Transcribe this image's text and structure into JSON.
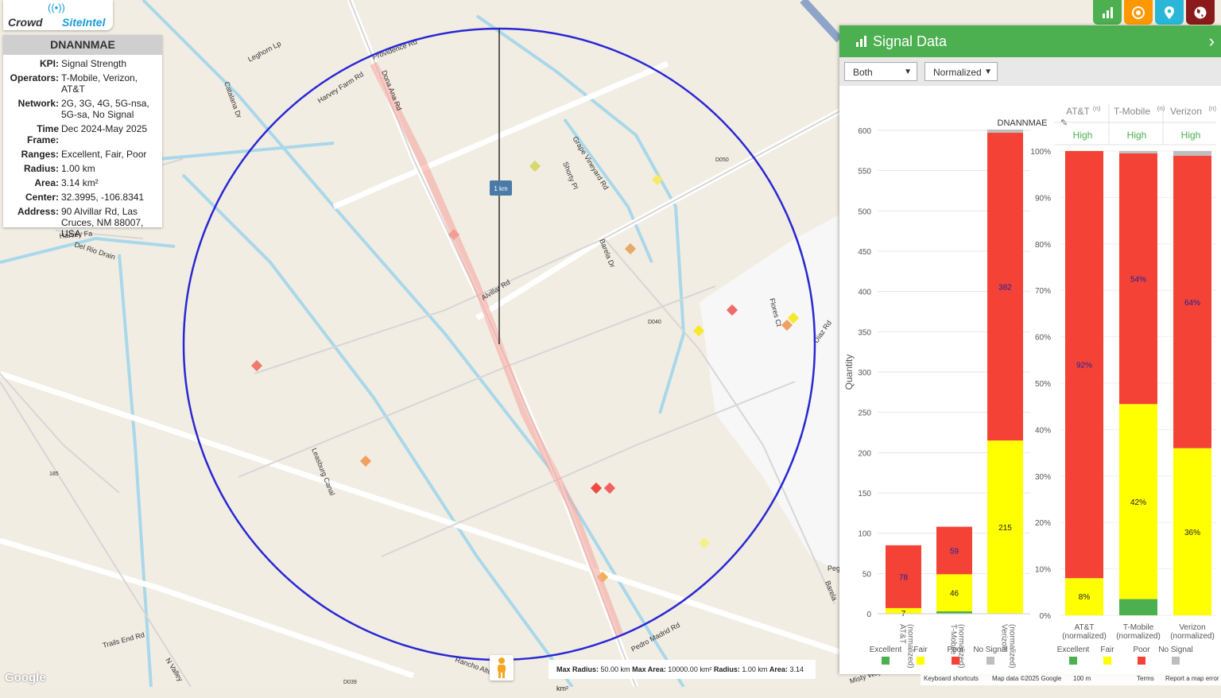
{
  "app": {
    "logo_left": "Crowd",
    "logo_right": "SiteIntel"
  },
  "info": {
    "title": "DNANNMAE",
    "rows": [
      {
        "k": "KPI:",
        "v": "Signal Strength"
      },
      {
        "k": "Operators:",
        "v": "T-Mobile, Verizon, AT&T"
      },
      {
        "k": "Network:",
        "v": "2G, 3G, 4G, 5G-nsa, 5G-sa, No Signal"
      },
      {
        "k": "Time Frame:",
        "v": "Dec 2024-May 2025"
      },
      {
        "k": "Ranges:",
        "v": "Excellent, Fair, Poor"
      },
      {
        "k": "Radius:",
        "v": "1.00 km"
      },
      {
        "k": "Area:",
        "v": "3.14 km²"
      },
      {
        "k": "Center:",
        "v": "32.3995, -106.8341"
      },
      {
        "k": "Address:",
        "v": "90 Alvillar Rd, Las Cruces, NM 88007, USA"
      }
    ]
  },
  "top_buttons": [
    {
      "icon": "bar-chart-icon",
      "color": "#4caf50"
    },
    {
      "icon": "target-icon",
      "color": "#ff9800"
    },
    {
      "icon": "location-pin-icon",
      "color": "#29b6d8"
    },
    {
      "icon": "globe-icon",
      "color": "#8b1a1a"
    }
  ],
  "map": {
    "scale_label": "1 km",
    "roads": [
      "Dona Ana Rd",
      "Alvillar Rd",
      "Harvey Farm Rd",
      "Providence Rd",
      "Leghorn Lp",
      "Catalana Dr",
      "Del Rio Drain",
      "Harvey Fa",
      "Leasburg Canal",
      "Barela Dr",
      "Grape Vineyard Rd",
      "Shorty Pl",
      "Flores Ct",
      "Diaz Rd",
      "Pedro Madrid Rd",
      "Trails End Rd",
      "N Valley",
      "Rancho Alto",
      "Peg",
      "Barela",
      "D050",
      "D040",
      "D039",
      "185",
      "Misty Way"
    ]
  },
  "bottom_stats": {
    "max_radius_label": "Max Radius:",
    "max_radius": "50.00 km",
    "max_area_label": "Max Area:",
    "max_area": "10000.00 km²",
    "radius_label": "Radius:",
    "radius": "1.00 km",
    "area_label": "Area:",
    "area": "3.14 km²"
  },
  "map_footer": {
    "keyboard": "Keyboard shortcuts",
    "mapdata": "Map data ©2025 Google",
    "scale": "100 m",
    "terms": "Terms",
    "report": "Report a map error",
    "google": "Google"
  },
  "panel": {
    "title": "Signal Data",
    "select_1": "Both",
    "select_2": "Normalized"
  },
  "colors": {
    "excellent": "#4caf50",
    "fair": "#ffff00",
    "poor": "#f44336",
    "nosignal": "#bdbdbd",
    "circle": "#2828d4"
  },
  "chart_data": [
    {
      "type": "bar",
      "title": "DNANNMAE",
      "ylabel": "Quantity",
      "ylim": [
        0,
        600
      ],
      "yticks": [
        0,
        50,
        100,
        150,
        200,
        250,
        300,
        350,
        400,
        450,
        500,
        550,
        600
      ],
      "categories": [
        "AT&T (normalized)",
        "T-Mobile (normalized)",
        "Verizon (normalized)"
      ],
      "series": [
        {
          "name": "Excellent",
          "values": [
            0,
            3,
            0
          ]
        },
        {
          "name": "Fair",
          "values": [
            7,
            46,
            215
          ]
        },
        {
          "name": "Poor",
          "values": [
            78,
            59,
            382
          ]
        },
        {
          "name": "No Signal",
          "values": [
            0,
            0,
            4
          ]
        }
      ],
      "labels": {
        "Fair": [
          "7",
          "46",
          "215"
        ],
        "Poor": [
          "78",
          "59",
          "382"
        ]
      }
    },
    {
      "type": "bar",
      "ylim": [
        0,
        100
      ],
      "yticks": [
        "0%",
        "10%",
        "20%",
        "30%",
        "40%",
        "50%",
        "60%",
        "70%",
        "80%",
        "90%",
        "100%"
      ],
      "headers": [
        "AT&T",
        "T-Mobile",
        "Verizon"
      ],
      "header_sup": "(n)",
      "ratings": [
        "High",
        "High",
        "High"
      ],
      "categories": [
        "AT&T (normalized)",
        "T-Mobile (normalized)",
        "Verizon (normalized)"
      ],
      "series": [
        {
          "name": "Excellent",
          "values": [
            0,
            3.5,
            0
          ]
        },
        {
          "name": "Fair",
          "values": [
            8,
            42,
            36
          ]
        },
        {
          "name": "Poor",
          "values": [
            92,
            54,
            63
          ]
        },
        {
          "name": "No Signal",
          "values": [
            0,
            0.5,
            1
          ]
        }
      ],
      "labels": {
        "Fair": [
          "8%",
          "42%",
          "36%"
        ],
        "Poor": [
          "92%",
          "54%",
          "64%"
        ]
      }
    }
  ],
  "legend": [
    "Excellent",
    "Fair",
    "Poor",
    "No Signal"
  ]
}
